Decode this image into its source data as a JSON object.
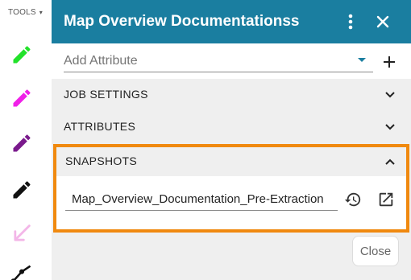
{
  "tools": {
    "header_label": "TOOLS",
    "header_caret": "▾",
    "items": [
      {
        "icon": "pencil-icon",
        "color": "#22e22a"
      },
      {
        "icon": "pencil-icon",
        "color": "#f020e8"
      },
      {
        "icon": "pencil-icon",
        "color": "#7a1a8c"
      },
      {
        "icon": "pencil-icon",
        "color": "#111111"
      },
      {
        "icon": "arrow-icon",
        "color": "#f3b6e8"
      },
      {
        "icon": "polyline-icon",
        "color": "#111111"
      }
    ]
  },
  "panel": {
    "title": "Map Overview Documentationss",
    "header_color": "#1a7ea0",
    "more_icon": "more-vert-icon",
    "close_icon": "close-icon",
    "add_attribute": {
      "placeholder": "Add Attribute",
      "add_icon": "plus-icon"
    },
    "sections": [
      {
        "label": "JOB SETTINGS",
        "expanded": false
      },
      {
        "label": "ATTRIBUTES",
        "expanded": false
      },
      {
        "label": "SNAPSHOTS",
        "expanded": true
      }
    ],
    "snapshot": {
      "name": "Map_Overview_Documentation_Pre-Extraction",
      "history_icon": "history-icon",
      "open_icon": "open-in-new-icon"
    },
    "highlight_color": "#f0890f",
    "close_label": "Close"
  }
}
